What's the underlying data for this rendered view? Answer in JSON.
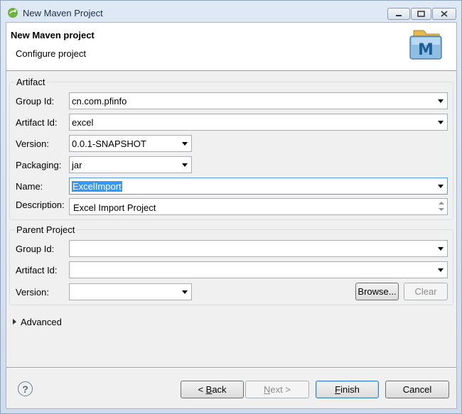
{
  "window": {
    "title": "New Maven Project"
  },
  "banner": {
    "title": "New Maven project",
    "subtitle": "Configure project",
    "logo_letter": "M"
  },
  "artifact": {
    "label": "Artifact",
    "group_id": {
      "label": "Group Id:",
      "value": "cn.com.pfinfo"
    },
    "artifact_id": {
      "label": "Artifact Id:",
      "value": "excel"
    },
    "version": {
      "label": "Version:",
      "value": "0.0.1-SNAPSHOT"
    },
    "packaging": {
      "label": "Packaging:",
      "value": "jar"
    },
    "name": {
      "label": "Name:",
      "value": "ExcelImport"
    },
    "description": {
      "label": "Description:",
      "value": "Excel Import Project"
    }
  },
  "parent": {
    "label": "Parent Project",
    "group_id": {
      "label": "Group Id:",
      "value": ""
    },
    "artifact_id": {
      "label": "Artifact Id:",
      "value": ""
    },
    "version": {
      "label": "Version:",
      "value": ""
    },
    "browse_label": "Browse...",
    "clear_label": "Clear"
  },
  "advanced": {
    "label": "Advanced"
  },
  "buttons": {
    "help_glyph": "?",
    "back_prefix": "< ",
    "back_mnemonic": "B",
    "back_rest": "ack",
    "next_mnemonic": "N",
    "next_rest": "ext >",
    "finish_mnemonic": "F",
    "finish_rest": "inish",
    "cancel": "Cancel"
  }
}
